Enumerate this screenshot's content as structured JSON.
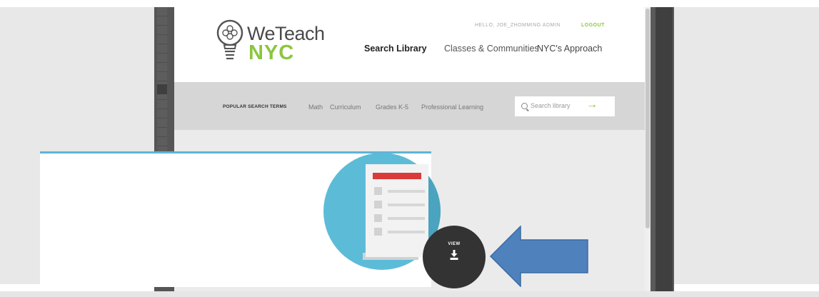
{
  "site": {
    "logo": {
      "word": "WeTeach",
      "city": "NYC"
    },
    "account": {
      "user": "HELLO, JOE_ZHOMMING ADMIN",
      "logout": "LOGOUT"
    },
    "nav": [
      "Search Library",
      "Classes & Communities",
      "NYC's Approach"
    ]
  },
  "searchbar": {
    "label": "POPULAR SEARCH TERMS",
    "terms": [
      "Math",
      "Curriculum",
      "Grades K-5",
      "Professional Learning"
    ],
    "placeholder": "Search library",
    "submit_icon": "arrow-right-icon"
  },
  "resource": {
    "view_label": "VIEW",
    "action_icon": "download-icon"
  },
  "colors": {
    "brand_green": "#8cc63f",
    "accent_blue": "#5fb3d6",
    "annotation_arrow": "#4f81bd",
    "view_button": "#333333"
  }
}
